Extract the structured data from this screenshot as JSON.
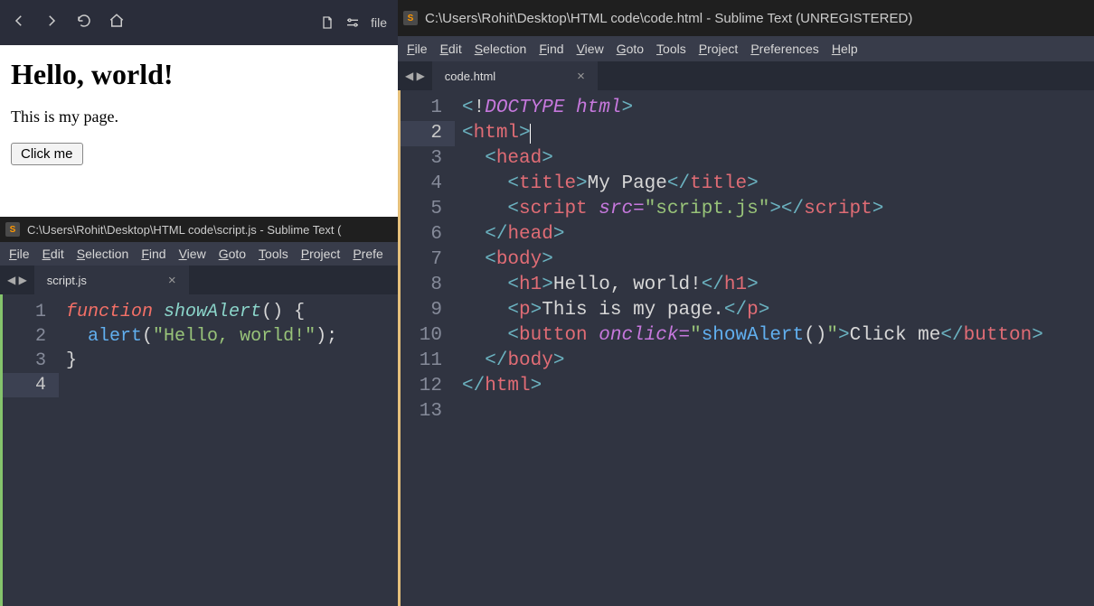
{
  "browser": {
    "url_fragment": "file",
    "page": {
      "heading": "Hello, world!",
      "paragraph": "This is my page.",
      "button_label": "Click me"
    }
  },
  "editor_left": {
    "title": "C:\\Users\\Rohit\\Desktop\\HTML code\\script.js - Sublime Text (",
    "menu": [
      "File",
      "Edit",
      "Selection",
      "Find",
      "View",
      "Goto",
      "Tools",
      "Project",
      "Prefe"
    ],
    "tab": "script.js",
    "line_numbers": [
      "1",
      "2",
      "3",
      "4"
    ],
    "code_lines": [
      [
        {
          "c": "kw",
          "t": "function"
        },
        {
          "c": "pn",
          "t": " "
        },
        {
          "c": "fn",
          "t": "showAlert"
        },
        {
          "c": "pn",
          "t": "() {"
        }
      ],
      [
        {
          "c": "pn",
          "t": "  "
        },
        {
          "c": "call",
          "t": "alert"
        },
        {
          "c": "pn",
          "t": "("
        },
        {
          "c": "str",
          "t": "\"Hello, world!\""
        },
        {
          "c": "pn",
          "t": ");"
        }
      ],
      [
        {
          "c": "pn",
          "t": "}"
        }
      ],
      []
    ],
    "active_line_index": 3
  },
  "editor_right": {
    "title": "C:\\Users\\Rohit\\Desktop\\HTML code\\code.html - Sublime Text (UNREGISTERED)",
    "menu": [
      "File",
      "Edit",
      "Selection",
      "Find",
      "View",
      "Goto",
      "Tools",
      "Project",
      "Preferences",
      "Help"
    ],
    "tab": "code.html",
    "line_numbers": [
      "1",
      "2",
      "3",
      "4",
      "5",
      "6",
      "7",
      "8",
      "9",
      "10",
      "11",
      "12",
      "13"
    ],
    "active_line_index": 1,
    "code_lines": [
      [
        {
          "c": "tagop",
          "t": "<"
        },
        {
          "c": "doctype-b",
          "t": "!"
        },
        {
          "c": "doctype-i",
          "t": "DOCTYPE html"
        },
        {
          "c": "tagop",
          "t": ">"
        }
      ],
      [
        {
          "c": "tagop",
          "t": "<"
        },
        {
          "c": "tagname",
          "t": "html"
        },
        {
          "c": "tagop",
          "t": ">"
        },
        {
          "c": "cursor",
          "t": ""
        }
      ],
      [
        {
          "c": "pn",
          "t": "  "
        },
        {
          "c": "tagop",
          "t": "<"
        },
        {
          "c": "tagname",
          "t": "head"
        },
        {
          "c": "tagop",
          "t": ">"
        }
      ],
      [
        {
          "c": "pn",
          "t": "    "
        },
        {
          "c": "tagop",
          "t": "<"
        },
        {
          "c": "tagname",
          "t": "title"
        },
        {
          "c": "tagop",
          "t": ">"
        },
        {
          "c": "txt",
          "t": "My Page"
        },
        {
          "c": "tagop",
          "t": "</"
        },
        {
          "c": "tagname",
          "t": "title"
        },
        {
          "c": "tagop",
          "t": ">"
        }
      ],
      [
        {
          "c": "pn",
          "t": "    "
        },
        {
          "c": "tagop",
          "t": "<"
        },
        {
          "c": "tagname",
          "t": "script"
        },
        {
          "c": "pn",
          "t": " "
        },
        {
          "c": "attr",
          "t": "src"
        },
        {
          "c": "op",
          "t": "="
        },
        {
          "c": "str",
          "t": "\"script.js\""
        },
        {
          "c": "tagop",
          "t": "></"
        },
        {
          "c": "tagname",
          "t": "script"
        },
        {
          "c": "tagop",
          "t": ">"
        }
      ],
      [
        {
          "c": "pn",
          "t": "  "
        },
        {
          "c": "tagop",
          "t": "</"
        },
        {
          "c": "tagname",
          "t": "head"
        },
        {
          "c": "tagop",
          "t": ">"
        }
      ],
      [
        {
          "c": "pn",
          "t": "  "
        },
        {
          "c": "tagop",
          "t": "<"
        },
        {
          "c": "tagname",
          "t": "body"
        },
        {
          "c": "tagop",
          "t": ">"
        }
      ],
      [
        {
          "c": "pn",
          "t": "    "
        },
        {
          "c": "tagop",
          "t": "<"
        },
        {
          "c": "tagname",
          "t": "h1"
        },
        {
          "c": "tagop",
          "t": ">"
        },
        {
          "c": "txt",
          "t": "Hello, world!"
        },
        {
          "c": "tagop",
          "t": "</"
        },
        {
          "c": "tagname",
          "t": "h1"
        },
        {
          "c": "tagop",
          "t": ">"
        }
      ],
      [
        {
          "c": "pn",
          "t": "    "
        },
        {
          "c": "tagop",
          "t": "<"
        },
        {
          "c": "tagname",
          "t": "p"
        },
        {
          "c": "tagop",
          "t": ">"
        },
        {
          "c": "txt",
          "t": "This is my page."
        },
        {
          "c": "tagop",
          "t": "</"
        },
        {
          "c": "tagname",
          "t": "p"
        },
        {
          "c": "tagop",
          "t": ">"
        }
      ],
      [
        {
          "c": "pn",
          "t": "    "
        },
        {
          "c": "tagop",
          "t": "<"
        },
        {
          "c": "tagname",
          "t": "button"
        },
        {
          "c": "pn",
          "t": " "
        },
        {
          "c": "attr",
          "t": "onclick"
        },
        {
          "c": "op",
          "t": "="
        },
        {
          "c": "str",
          "t": "\""
        },
        {
          "c": "call",
          "t": "showAlert"
        },
        {
          "c": "pn",
          "t": "()"
        },
        {
          "c": "str",
          "t": "\""
        },
        {
          "c": "tagop",
          "t": ">"
        },
        {
          "c": "txt",
          "t": "Click me"
        },
        {
          "c": "tagop",
          "t": "</"
        },
        {
          "c": "tagname",
          "t": "button"
        },
        {
          "c": "tagop",
          "t": ">"
        }
      ],
      [
        {
          "c": "pn",
          "t": "  "
        },
        {
          "c": "tagop",
          "t": "</"
        },
        {
          "c": "tagname",
          "t": "body"
        },
        {
          "c": "tagop",
          "t": ">"
        }
      ],
      [
        {
          "c": "tagop",
          "t": "</"
        },
        {
          "c": "tagname",
          "t": "html"
        },
        {
          "c": "tagop",
          "t": ">"
        }
      ],
      []
    ]
  }
}
